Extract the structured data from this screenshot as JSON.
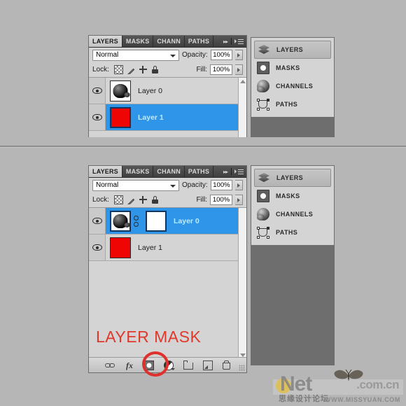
{
  "meta": {
    "app": "Adobe Photoshop Layers Panel",
    "background_color": "#b6b6b6",
    "accent_selected": "#2e95e8",
    "annotation_color": "#e0392c"
  },
  "panels": {
    "top": {
      "tabs": [
        {
          "label": "LAYERS",
          "active": true
        },
        {
          "label": "MASKS",
          "active": false
        },
        {
          "label": "CHANN",
          "active": false
        },
        {
          "label": "PATHS",
          "active": false
        }
      ],
      "collapse_arrows": "▸▸",
      "menu_icon": "panel-menu-icon",
      "blend_mode": "Normal",
      "opacity_label": "Opacity:",
      "opacity_value": "100%",
      "lock_label": "Lock:",
      "lock_icons": [
        "lock-transparent-pixels",
        "lock-image-pixels",
        "lock-position",
        "lock-all"
      ],
      "fill_label": "Fill:",
      "fill_value": "100%",
      "layers": [
        {
          "name": "Layer 0",
          "selected": false,
          "thumb": "photo",
          "visible": true,
          "has_mask": false
        },
        {
          "name": "Layer 1",
          "selected": true,
          "thumb": "red",
          "visible": true,
          "has_mask": false
        }
      ]
    },
    "bottom": {
      "tabs": [
        {
          "label": "LAYERS",
          "active": true
        },
        {
          "label": "MASKS",
          "active": false
        },
        {
          "label": "CHANN",
          "active": false
        },
        {
          "label": "PATHS",
          "active": false
        }
      ],
      "collapse_arrows": "▸▸",
      "menu_icon": "panel-menu-icon",
      "blend_mode": "Normal",
      "opacity_label": "Opacity:",
      "opacity_value": "100%",
      "lock_label": "Lock:",
      "lock_icons": [
        "lock-transparent-pixels",
        "lock-image-pixels",
        "lock-position",
        "lock-all"
      ],
      "fill_label": "Fill:",
      "fill_value": "100%",
      "layers": [
        {
          "name": "Layer 0",
          "selected": true,
          "thumb": "photo",
          "visible": true,
          "has_mask": true
        },
        {
          "name": "Layer 1",
          "selected": false,
          "thumb": "red",
          "visible": true,
          "has_mask": false
        }
      ],
      "footer_buttons": [
        "link-layers-icon",
        "add-layer-style-icon",
        "add-layer-mask-icon",
        "new-adjustment-layer-icon",
        "new-group-icon",
        "new-layer-icon",
        "delete-layer-icon"
      ]
    }
  },
  "icon_docks": {
    "top": [
      {
        "label": "LAYERS",
        "icon": "layers-stack-icon",
        "active": true
      },
      {
        "label": "MASKS",
        "icon": "mask-icon",
        "active": false
      },
      {
        "label": "CHANNELS",
        "icon": "channels-sphere-icon",
        "active": false
      },
      {
        "label": "PATHS",
        "icon": "paths-pen-icon",
        "active": false
      }
    ],
    "bottom": [
      {
        "label": "LAYERS",
        "icon": "layers-stack-icon",
        "active": true
      },
      {
        "label": "MASKS",
        "icon": "mask-icon",
        "active": false
      },
      {
        "label": "CHANNELS",
        "icon": "channels-sphere-icon",
        "active": false
      },
      {
        "label": "PATHS",
        "icon": "paths-pen-icon",
        "active": false
      }
    ]
  },
  "annotations": {
    "layer_mask_caption": "LAYER MASK",
    "highlight_circle": "add-layer-mask-button-highlight"
  },
  "watermark": {
    "brand": "Net",
    "domain": ".com.cn",
    "cn_text": "思缘设计论坛",
    "url": "WWW.MISSYUAN.COM",
    "butterfly": "butterfly-icon"
  }
}
